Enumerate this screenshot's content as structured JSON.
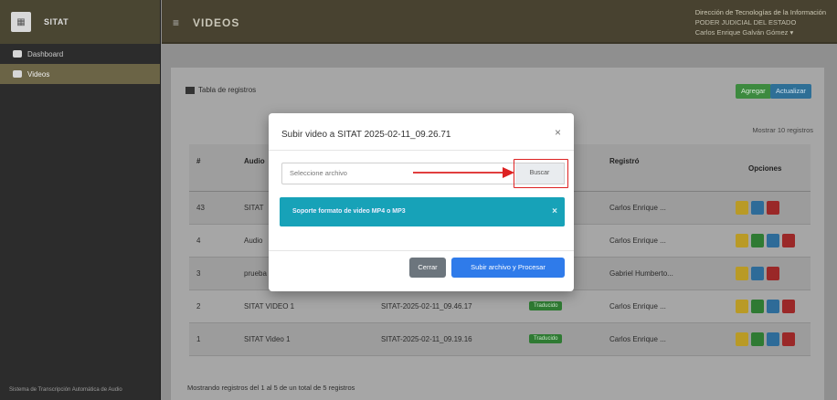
{
  "sidebar": {
    "brand": "SITAT",
    "items": [
      {
        "label": "Dashboard"
      },
      {
        "label": "Videos"
      }
    ],
    "footer": "Sistema de Transcripción Automática de Audio"
  },
  "header": {
    "menu_icon": "≡",
    "title": "VIDEOS",
    "dept_line": "Dirección de Tecnologías de la Información",
    "org_line": "PODER JUDICIAL DEL ESTADO",
    "user_line": "Carlos Enrique Galván Gómez ▾"
  },
  "card": {
    "title": "Tabla de registros",
    "btn_add": "Agregar",
    "btn_refresh": "Actualizar",
    "show_entries": "Mostrar 10 registros"
  },
  "table": {
    "headers": [
      "#",
      "Audio",
      "Registró",
      "Opciones"
    ],
    "rows": [
      {
        "id": "43",
        "name": "SITAT",
        "file": "",
        "status": "",
        "user": "Carlos Enrique ...",
        "opts": [
          "y",
          "b",
          "r"
        ]
      },
      {
        "id": "4",
        "name": "Audio",
        "file": "",
        "status": "",
        "user": "Carlos Enrique ...",
        "opts": [
          "y",
          "g",
          "b",
          "r"
        ]
      },
      {
        "id": "3",
        "name": "prueba",
        "file": "",
        "status": "",
        "user": "Gabriel Humberto...",
        "opts": [
          "y",
          "b",
          "r"
        ]
      },
      {
        "id": "2",
        "name": "SITAT VIDEO 1",
        "file": "SITAT-2025-02-11_09.46.17",
        "status": "Traducido",
        "user": "Carlos Enrique ...",
        "opts": [
          "y",
          "g",
          "b",
          "r"
        ]
      },
      {
        "id": "1",
        "name": "SITAT Video 1",
        "file": "SITAT-2025-02-11_09.19.16",
        "status": "Traducido",
        "user": "Carlos Enrique ...",
        "opts": [
          "y",
          "g",
          "b",
          "r"
        ]
      }
    ],
    "footer": "Mostrando registros del 1 al 5 de un total de 5 registros"
  },
  "modal": {
    "title": "Subir video a SITAT 2025-02-11_09.26.71",
    "file_placeholder": "Seleccione archivo",
    "browse_label": "Buscar",
    "alert": "Soporte formato de video MP4 o MP3",
    "btn_close": "Cerrar",
    "btn_upload": "Subir archivo y Procesar"
  },
  "colors": {
    "primary": "#2f7bea",
    "info": "#17a2b8",
    "header_bg": "#484230",
    "arrow": "#dd2222"
  }
}
